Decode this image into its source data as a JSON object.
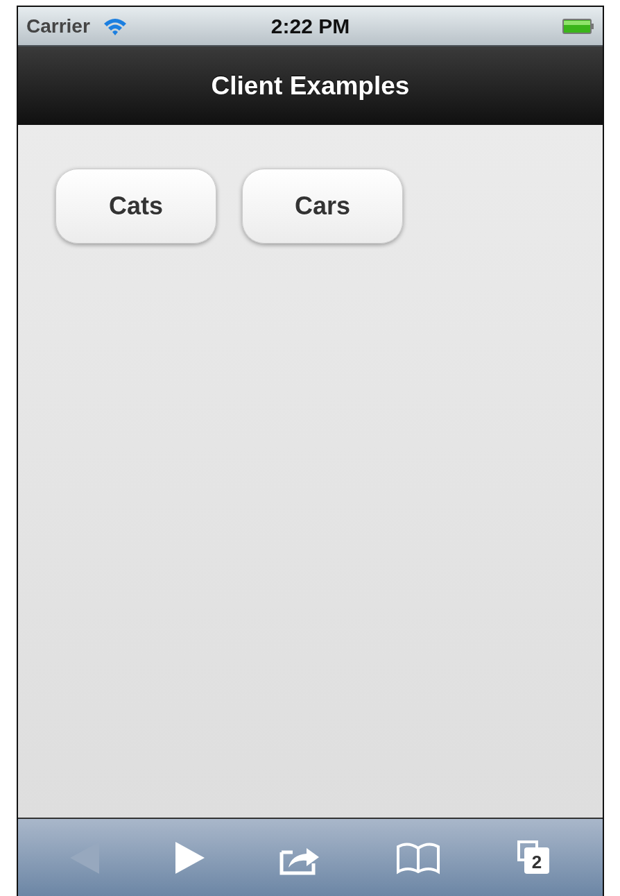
{
  "status_bar": {
    "carrier": "Carrier",
    "time": "2:22 PM"
  },
  "nav_bar": {
    "title": "Client Examples"
  },
  "buttons": [
    {
      "label": "Cats"
    },
    {
      "label": "Cars"
    }
  ],
  "toolbar": {
    "items": [
      {
        "kind": "back",
        "disabled": true
      },
      {
        "kind": "forward",
        "disabled": false
      },
      {
        "kind": "share",
        "disabled": false
      },
      {
        "kind": "bookmarks",
        "disabled": false
      },
      {
        "kind": "tabs",
        "disabled": false,
        "count": "2"
      }
    ]
  }
}
